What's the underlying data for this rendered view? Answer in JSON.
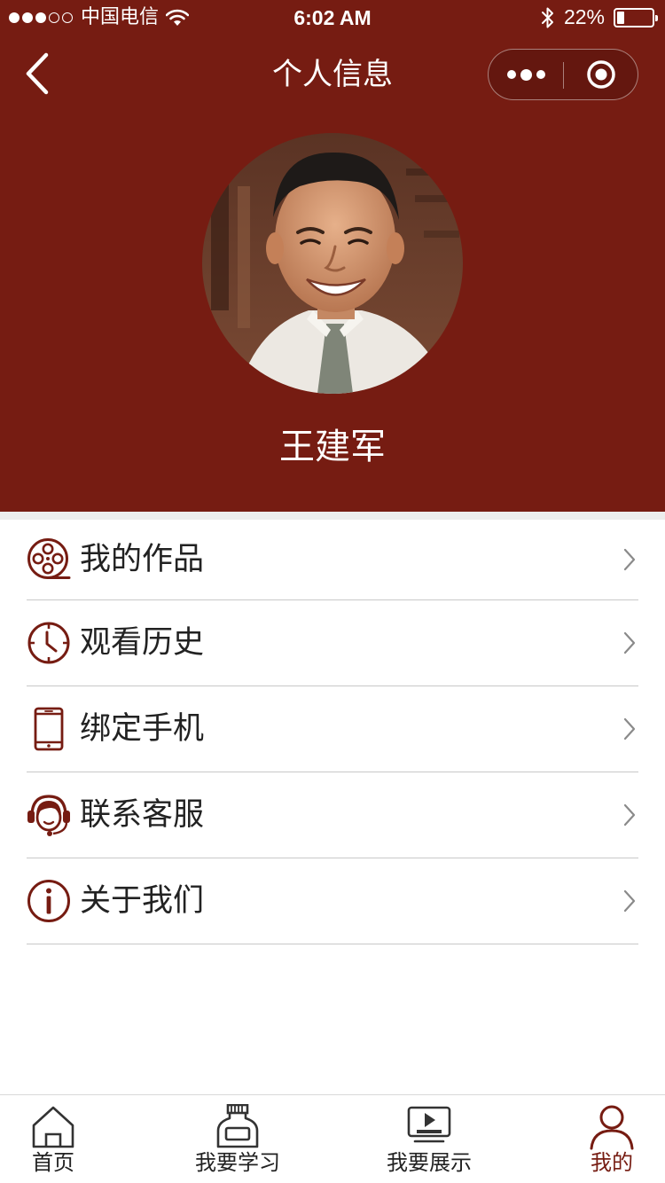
{
  "status_bar": {
    "carrier": "中国电信",
    "time": "6:02 AM",
    "battery_percent_text": "22%",
    "battery_level": 0.22,
    "signal_bars_filled": 3,
    "signal_bars_total": 5
  },
  "navbar": {
    "title": "个人信息",
    "back_icon": "chevron-left-icon",
    "more_icon": "more-dots-icon",
    "close_icon": "target-close-icon"
  },
  "profile": {
    "name": "王建军",
    "avatar": "avatar-photo"
  },
  "menu": [
    {
      "label": "我的作品",
      "icon": "film-reel-icon"
    },
    {
      "label": "观看历史",
      "icon": "clock-icon"
    },
    {
      "label": "绑定手机",
      "icon": "phone-icon"
    },
    {
      "label": "联系客服",
      "icon": "headset-icon"
    },
    {
      "label": "关于我们",
      "icon": "info-icon"
    }
  ],
  "tabbar": {
    "tabs": [
      {
        "label": "首页",
        "icon": "home-icon",
        "active": false
      },
      {
        "label": "我要学习",
        "icon": "inkbottle-icon",
        "active": false
      },
      {
        "label": "我要展示",
        "icon": "play-screen-icon",
        "active": false
      },
      {
        "label": "我的",
        "icon": "user-icon",
        "active": true
      }
    ]
  },
  "colors": {
    "brand": "#761c12",
    "divider": "#c8c8c8",
    "text": "#222222",
    "arrow": "#8a8a8a"
  }
}
